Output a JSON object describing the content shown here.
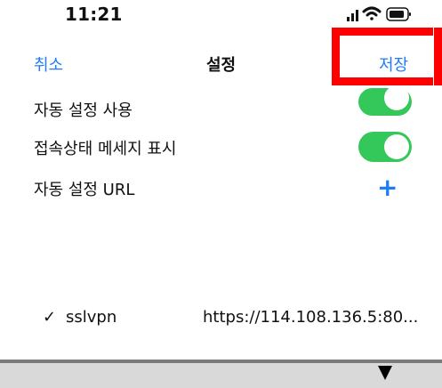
{
  "status_bar": {
    "time": "11:21",
    "icons": [
      "signal-icon",
      "wifi-icon",
      "battery-icon"
    ]
  },
  "nav": {
    "cancel_label": "취소",
    "title": "설정",
    "save_label": "저장"
  },
  "settings": {
    "auto_config": {
      "label": "자동 설정 사용",
      "enabled": true
    },
    "show_status_message": {
      "label": "접속상태 메세지 표시",
      "enabled": true
    },
    "auto_config_url": {
      "label": "자동 설정 URL",
      "add_icon": "plus-icon"
    }
  },
  "profile": {
    "selected": true,
    "name": "sslvpn",
    "url": "https://114.108.136.5:80..."
  },
  "colors": {
    "accent": "#1f7cf6",
    "toggle_on": "#34c759",
    "highlight": "#ff0000"
  }
}
